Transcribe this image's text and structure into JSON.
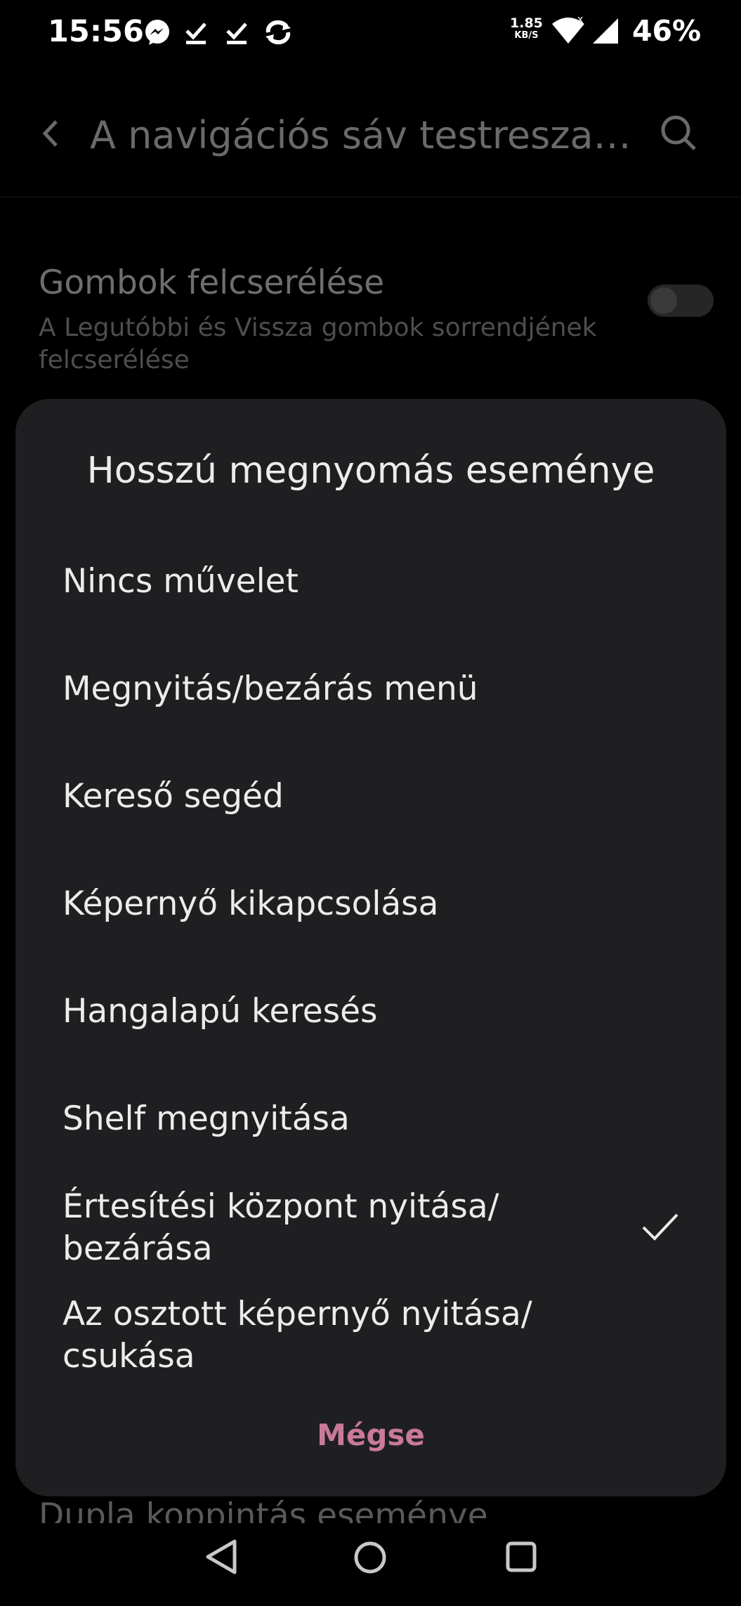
{
  "status_bar": {
    "time": "15:56",
    "speed_value": "1.85",
    "speed_unit": "KB/S",
    "battery": "46%"
  },
  "app_bar": {
    "title": "A navigációs sáv testreszabá…"
  },
  "settings": {
    "swap_title": "Gombok felcserélése",
    "swap_subtitle": "A Legutóbbi és Vissza gombok sorrendjének felcserélése",
    "double_tap_title": "Dupla koppintás eseménye"
  },
  "dialog": {
    "title": "Hosszú megnyomás eseménye",
    "options": [
      "Nincs művelet",
      "Megnyitás/bezárás menü",
      "Kereső segéd",
      "Képernyő kikapcsolása",
      "Hangalapú keresés",
      "Shelf megnyitása",
      "Értesítési központ nyitása/ bezárása",
      "Az osztott képernyő nyitása/ csukása"
    ],
    "selected_index": 6,
    "cancel": "Mégse"
  }
}
